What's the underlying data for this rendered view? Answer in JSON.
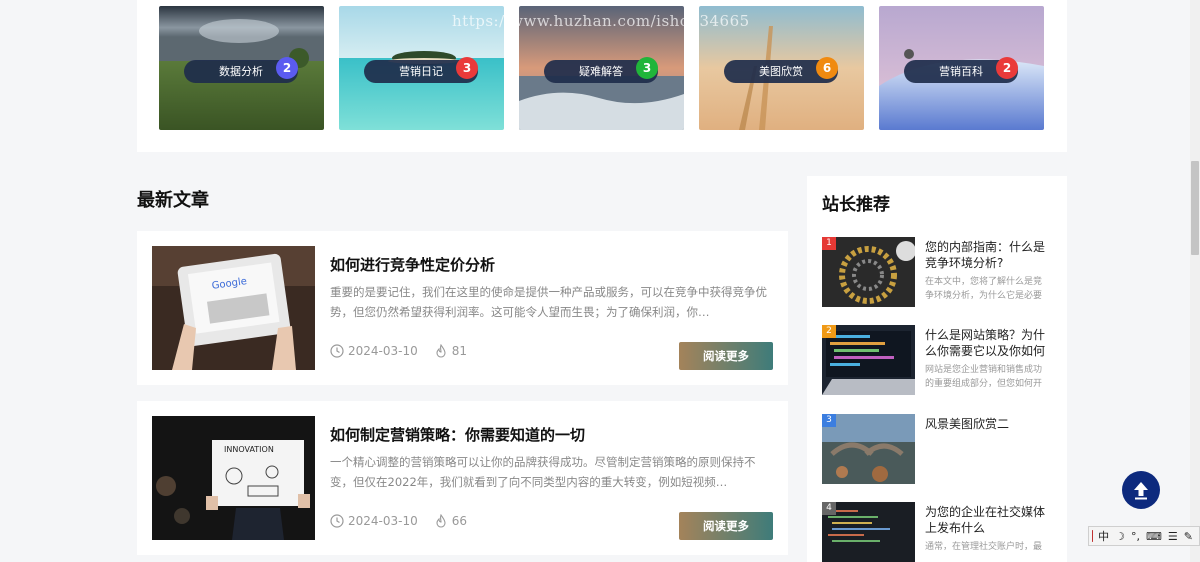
{
  "watermark": "https://www.huzhan.com/ishop34665",
  "categories": [
    {
      "label": "数据分析",
      "count": "2",
      "badge_color": "#5b5bf0"
    },
    {
      "label": "营销日记",
      "count": "3",
      "badge_color": "#ea3a3a"
    },
    {
      "label": "疑难解答",
      "count": "3",
      "badge_color": "#20b53a"
    },
    {
      "label": "美图欣赏",
      "count": "6",
      "badge_color": "#f08a10"
    },
    {
      "label": "营销百科",
      "count": "2",
      "badge_color": "#ea3a3a"
    }
  ],
  "latest": {
    "heading": "最新文章",
    "read_more_label": "阅读更多",
    "articles": [
      {
        "title": "如何进行竞争性定价分析",
        "excerpt": "重要的是要记住，我们在这里的使命是提供一种产品或服务，可以在竞争中获得竞争优势，但您仍然希望获得利润率。这可能令人望而生畏；为了确保利润，你…",
        "date": "2024-03-10",
        "views": "81"
      },
      {
        "title": "如何制定营销策略：你需要知道的一切",
        "excerpt": "一个精心调整的营销策略可以让你的品牌获得成功。尽管制定营销策略的原则保持不变，但仅在2022年，我们就看到了向不同类型内容的重大转变，例如短视频…",
        "date": "2024-03-10",
        "views": "66"
      }
    ]
  },
  "recommend": {
    "heading": "站长推荐",
    "items": [
      {
        "rank": "1",
        "rank_color": "#e53935",
        "title": "您的内部指南：什么是竞争环境分析?",
        "desc": "在本文中，您将了解什么是竞争环境分析，为什么它是必要"
      },
      {
        "rank": "2",
        "rank_color": "#f09a16",
        "title": "什么是网站策略？为什么你需要它以及你如何做到",
        "desc": "网站是您企业营销和销售成功的重要组成部分，但您如何开"
      },
      {
        "rank": "3",
        "rank_color": "#3b7ee0",
        "title": "风景美图欣赏二",
        "desc": ""
      },
      {
        "rank": "4",
        "rank_color": "#666666",
        "title": "为您的企业在社交媒体上发布什么",
        "desc": "通常，在管理社交账户时，最"
      }
    ]
  },
  "ime": {
    "lang": "中",
    "moon": "☽",
    "dots": "°,",
    "keyboard": "⌨",
    "menu": "☰",
    "tool": "✎"
  }
}
